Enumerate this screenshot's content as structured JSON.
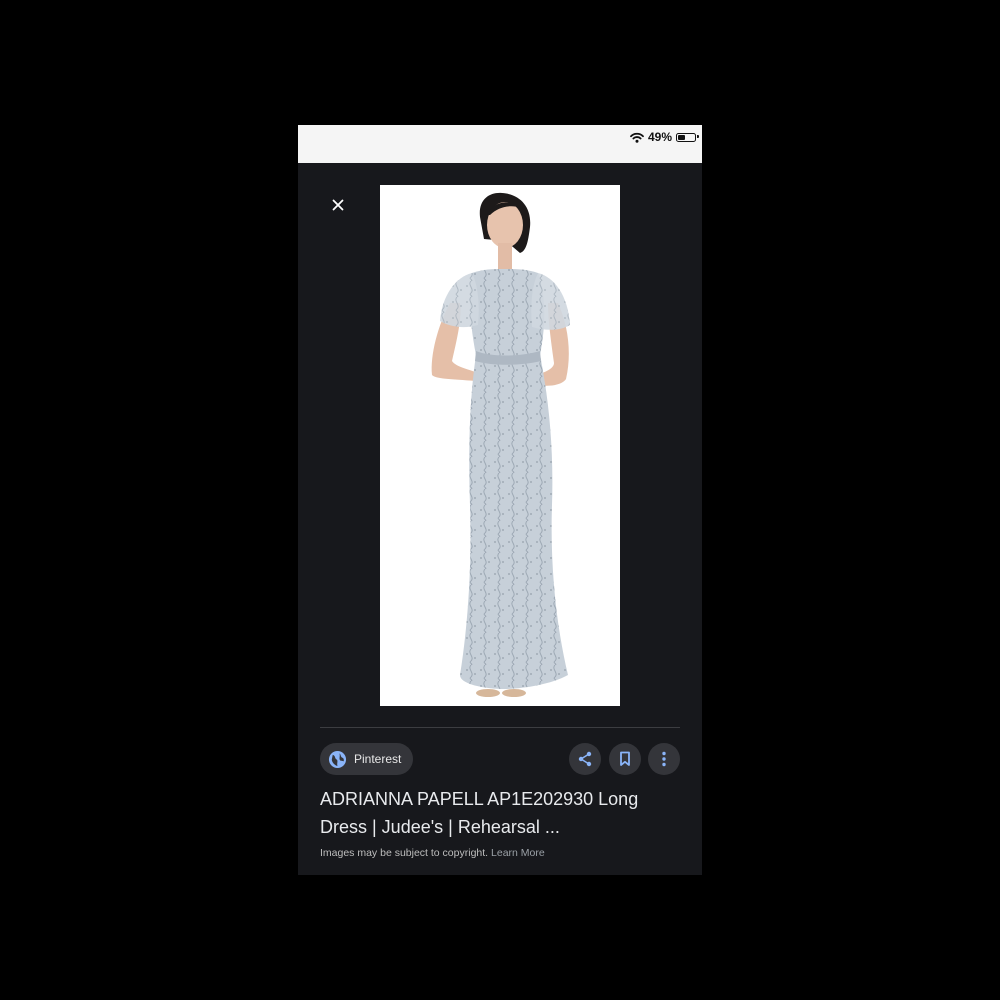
{
  "status_bar": {
    "battery_text": "49%",
    "battery_level": 0.49,
    "icons": [
      "wifi-icon",
      "battery-icon"
    ]
  },
  "viewer": {
    "close_icon": "close-icon",
    "image_subject": "model-wearing-long-beaded-dress"
  },
  "source": {
    "icon": "globe-icon",
    "label": "Pinterest"
  },
  "actions": [
    {
      "name": "share-icon"
    },
    {
      "name": "bookmark-icon"
    },
    {
      "name": "more-vert-icon"
    }
  ],
  "result": {
    "title": "ADRIANNA PAPELL AP1E202930 Long Dress | Judee's | Rehearsal ...",
    "copyright_text": "Images may be subject to copyright.",
    "learn_more": "Learn More"
  },
  "colors": {
    "background": "#17181c",
    "chip": "#34353a",
    "accent_blue": "#8ab4f8",
    "dress": "#c7d0d9"
  }
}
